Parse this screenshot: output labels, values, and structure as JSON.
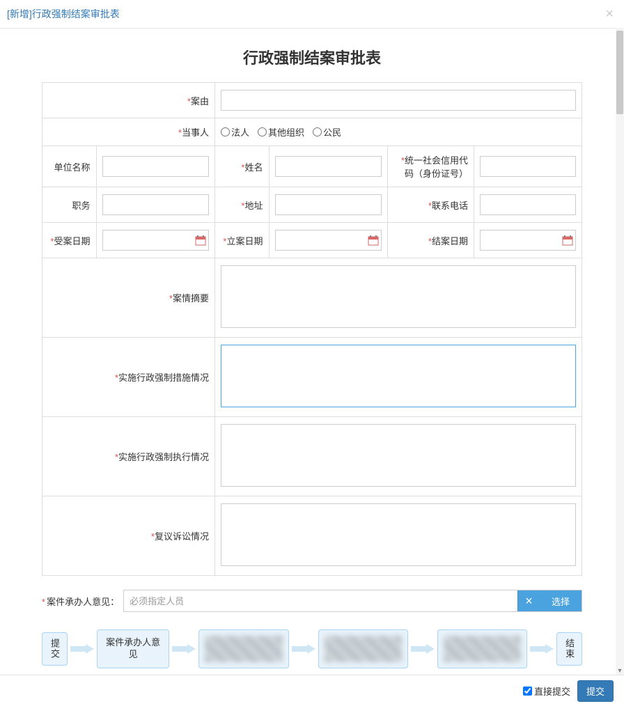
{
  "header": {
    "title": "[新增]行政强制结案审批表",
    "close_label": "×"
  },
  "form_title": "行政强制结案审批表",
  "labels": {
    "reason": "案由",
    "party": "当事人",
    "unit_name": "单位名称",
    "name": "姓名",
    "credit_code": "统一社会信用代码（身份证号）",
    "position": "职务",
    "address": "地址",
    "phone": "联系电话",
    "accept_date": "受案日期",
    "file_date": "立案日期",
    "close_date": "结案日期",
    "case_summary": "案情摘要",
    "measure_situation": "实施行政强制措施情况",
    "execute_situation": "实施行政强制执行情况",
    "review_situation": "复议诉讼情况"
  },
  "required_marker": "*",
  "party_options": {
    "legal": "法人",
    "other_org": "其他组织",
    "citizen": "公民"
  },
  "opinion": {
    "label": "案件承办人意见：",
    "placeholder": "必须指定人员",
    "clear": "×",
    "select": "选择"
  },
  "workflow": {
    "submit": "提交",
    "step2": "案件承办人意见",
    "end": "结束"
  },
  "footer": {
    "direct_submit": "直接提交",
    "submit": "提交"
  }
}
